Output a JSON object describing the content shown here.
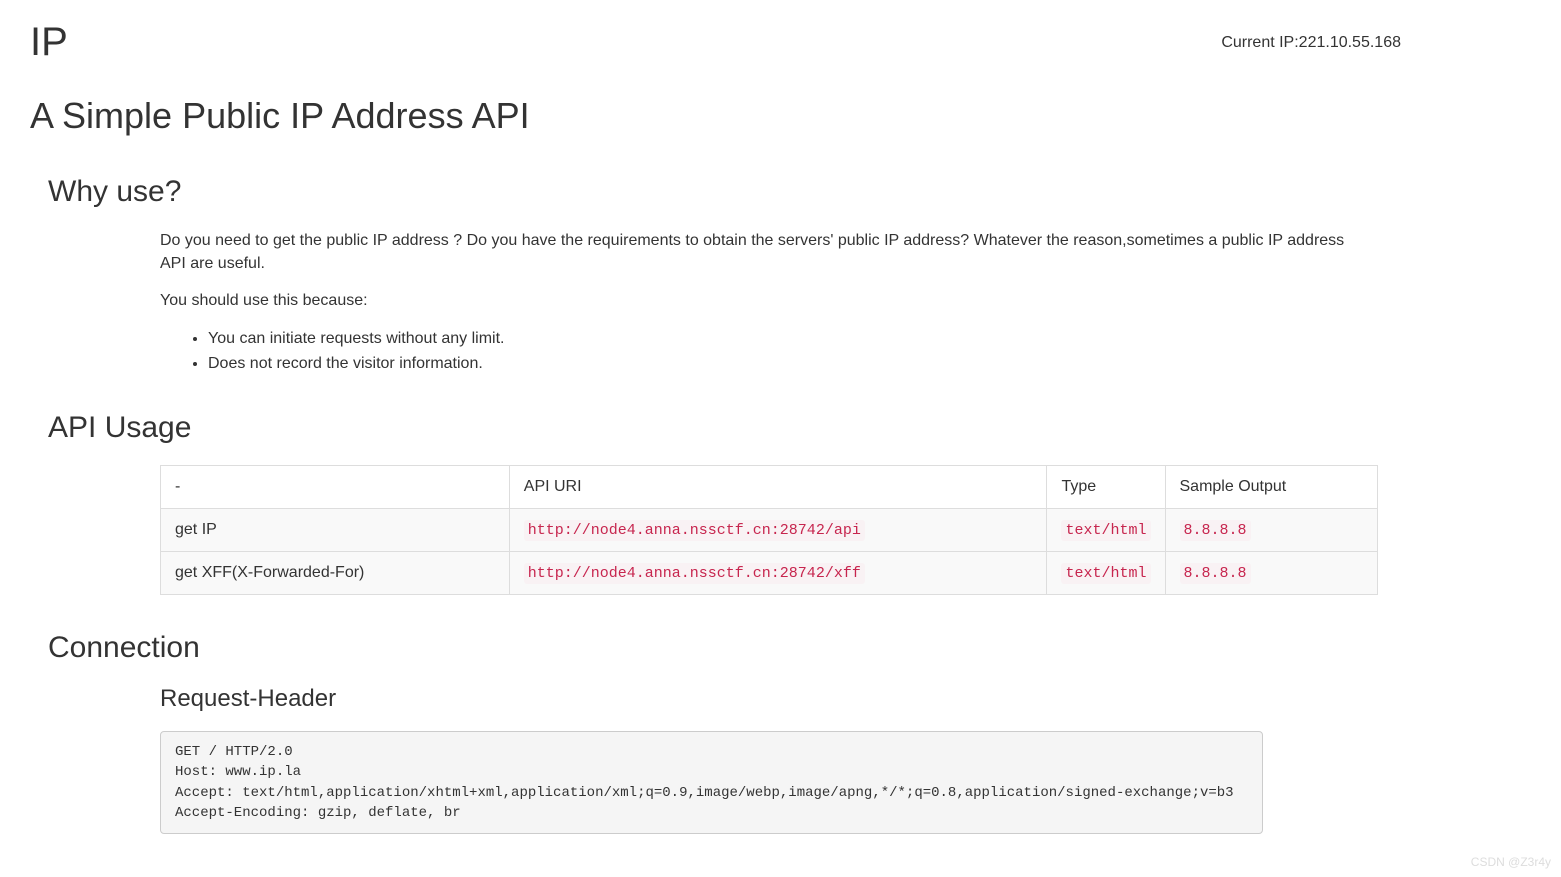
{
  "header": {
    "title": "IP",
    "current_ip_label": "Current IP:",
    "current_ip_value": "221.10.55.168"
  },
  "subtitle": "A Simple Public IP Address API",
  "why": {
    "heading": "Why use?",
    "para1": "Do you need to get the public IP address ? Do you have the requirements to obtain the servers' public IP address? Whatever the reason,sometimes a public IP address API are useful.",
    "para2": "You should use this because:",
    "bullets": [
      "You can initiate requests without any limit.",
      "Does not record the visitor information."
    ]
  },
  "api": {
    "heading": "API Usage",
    "columns": [
      "-",
      "API URI",
      "Type",
      "Sample Output"
    ],
    "rows": [
      {
        "name": "get IP",
        "uri": "http://node4.anna.nssctf.cn:28742/api",
        "type": "text/html",
        "sample": "8.8.8.8"
      },
      {
        "name": "get XFF(X-Forwarded-For)",
        "uri": "http://node4.anna.nssctf.cn:28742/xff",
        "type": "text/html",
        "sample": "8.8.8.8"
      }
    ]
  },
  "connection": {
    "heading": "Connection",
    "sub_heading": "Request-Header",
    "request": "GET / HTTP/2.0\nHost: www.ip.la\nAccept: text/html,application/xhtml+xml,application/xml;q=0.9,image/webp,image/apng,*/*;q=0.8,application/signed-exchange;v=b3\nAccept-Encoding: gzip, deflate, br"
  },
  "watermark": "CSDN @Z3r4y"
}
